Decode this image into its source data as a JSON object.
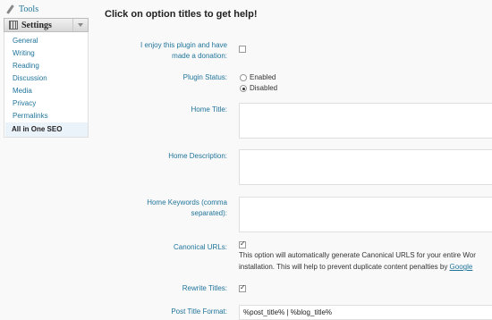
{
  "sidebar": {
    "tools_label": "Tools",
    "settings_label": "Settings",
    "items": [
      {
        "label": "General"
      },
      {
        "label": "Writing"
      },
      {
        "label": "Reading"
      },
      {
        "label": "Discussion"
      },
      {
        "label": "Media"
      },
      {
        "label": "Privacy"
      },
      {
        "label": "Permalinks"
      },
      {
        "label": "All in One SEO"
      }
    ],
    "current": "All in One SEO"
  },
  "main": {
    "heading": "Click on option titles to get help!",
    "donation": {
      "label_line1": "I enjoy this plugin and have",
      "label_line2": "made a donation:",
      "checked": false
    },
    "plugin_status": {
      "label": "Plugin Status:",
      "options": [
        "Enabled",
        "Disabled"
      ],
      "selected": "Disabled"
    },
    "home_title": {
      "label": "Home Title:",
      "value": ""
    },
    "home_description": {
      "label": "Home Description:",
      "value": ""
    },
    "home_keywords": {
      "label_line1": "Home Keywords (comma",
      "label_line2": "separated):",
      "value": ""
    },
    "canonical": {
      "label": "Canonical URLs:",
      "checked": true,
      "desc_line1": "This option will automatically generate Canonical URLS for your entire Wor",
      "desc_line2": "installation. This will help to prevent duplicate content penalties by ",
      "desc_link": "Google"
    },
    "rewrite_titles": {
      "label": "Rewrite Titles:",
      "checked": true
    },
    "post_title_format": {
      "label": "Post Title Format:",
      "value": "%post_title% | %blog_title%"
    }
  },
  "colors": {
    "link": "#21759b",
    "background": "#f9f9f9",
    "current_bg": "#eaf2fa"
  }
}
